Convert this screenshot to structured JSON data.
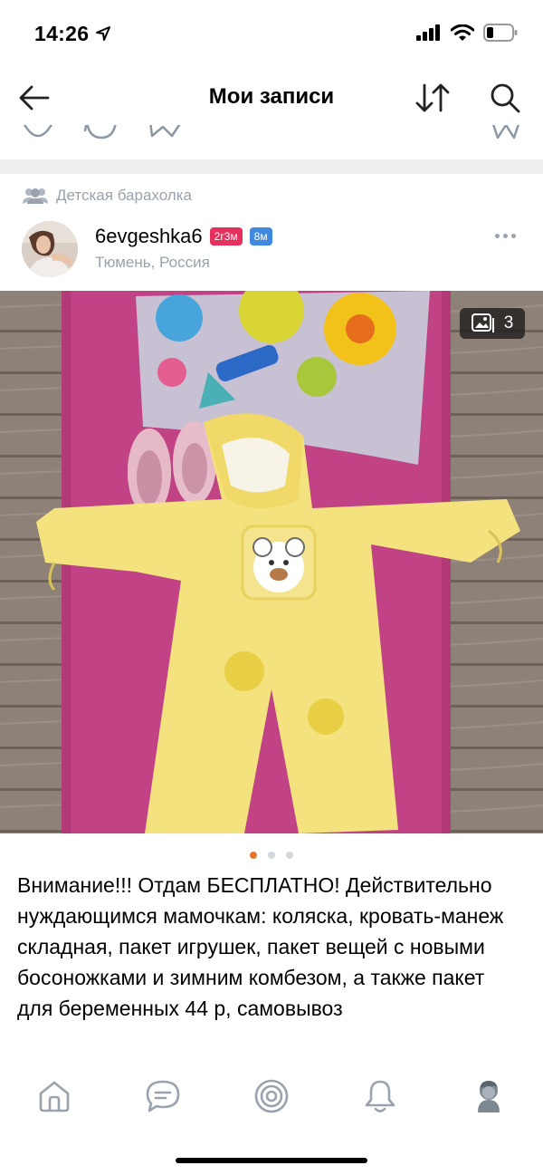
{
  "status_bar": {
    "time": "14:26",
    "icons": [
      "location-arrow-icon",
      "signal-icon",
      "wifi-icon",
      "battery-icon"
    ]
  },
  "header": {
    "title": "Мои записи",
    "back_icon": "arrow-left-icon",
    "sort_icon": "sort-arrows-icon",
    "search_icon": "search-icon"
  },
  "post": {
    "community": "Детская барахолка",
    "author": {
      "name": "6evgeshka6",
      "badge_age": "2г3м",
      "badge_time": "8м",
      "location": "Тюмень, Россия"
    },
    "photo": {
      "count": "3",
      "total_dots": 3,
      "active_index": 0
    },
    "text": "Внимание!!! Отдам БЕСПЛАТНО! Действительно нуждающимся мамочкам: коляска, кровать-манеж складная, пакет игрушек, пакет вещей с новыми босоножками  и зимним комбезом, а также пакет для беременных 44 р, самовывоз"
  },
  "tab_bar": {
    "tabs": [
      "home-icon",
      "messages-icon",
      "discover-icon",
      "notifications-icon",
      "profile-icon"
    ]
  },
  "colors": {
    "accent": "#3f8ae0",
    "badge_pink": "#e6315f",
    "muted": "#99a2ad",
    "active_dot": "#e8772e",
    "separator": "#edeef0"
  }
}
